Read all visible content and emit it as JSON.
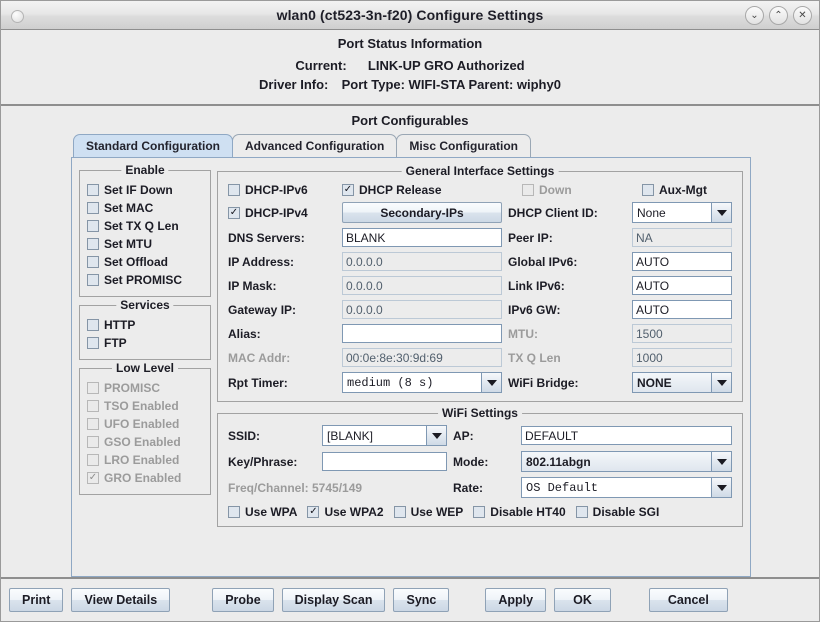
{
  "window": {
    "title": "wlan0  (ct523-3n-f20) Configure Settings",
    "buttons": [
      {
        "name": "minimize",
        "glyph": "⌄"
      },
      {
        "name": "maximize",
        "glyph": "⌃"
      },
      {
        "name": "close",
        "glyph": "✕"
      }
    ]
  },
  "status": {
    "heading": "Port Status Information",
    "current_label": "Current:",
    "current_value": "LINK-UP GRO  Authorized",
    "driver_label": "Driver Info:",
    "driver_value": "Port Type: WIFI-STA   Parent: wiphy0"
  },
  "port_configurables": {
    "heading": "Port Configurables",
    "tabs": [
      {
        "label": "Standard Configuration",
        "active": true
      },
      {
        "label": "Advanced Configuration",
        "active": false
      },
      {
        "label": "Misc Configuration",
        "active": false
      }
    ]
  },
  "enable_group": {
    "legend": "Enable",
    "items": [
      {
        "label": "Set IF Down",
        "checked": false,
        "disabled": false
      },
      {
        "label": "Set MAC",
        "checked": false,
        "disabled": false
      },
      {
        "label": "Set TX Q Len",
        "checked": false,
        "disabled": false
      },
      {
        "label": "Set MTU",
        "checked": false,
        "disabled": false
      },
      {
        "label": "Set Offload",
        "checked": false,
        "disabled": false
      },
      {
        "label": "Set PROMISC",
        "checked": false,
        "disabled": false
      }
    ]
  },
  "services_group": {
    "legend": "Services",
    "items": [
      {
        "label": "HTTP",
        "checked": false,
        "disabled": false
      },
      {
        "label": "FTP",
        "checked": false,
        "disabled": false
      }
    ]
  },
  "low_level_group": {
    "legend": "Low Level",
    "items": [
      {
        "label": "PROMISC",
        "checked": false,
        "disabled": true
      },
      {
        "label": "TSO Enabled",
        "checked": false,
        "disabled": true
      },
      {
        "label": "UFO Enabled",
        "checked": false,
        "disabled": true
      },
      {
        "label": "GSO Enabled",
        "checked": false,
        "disabled": true
      },
      {
        "label": "LRO Enabled",
        "checked": false,
        "disabled": true
      },
      {
        "label": "GRO Enabled",
        "checked": true,
        "disabled": true
      }
    ]
  },
  "general": {
    "legend": "General Interface Settings",
    "dhcp_ipv6": {
      "label": "DHCP-IPv6",
      "checked": false,
      "disabled": false
    },
    "dhcp_release": {
      "label": "DHCP Release",
      "checked": true,
      "disabled": false
    },
    "down": {
      "label": "Down",
      "checked": false,
      "disabled": true
    },
    "aux_mgt": {
      "label": "Aux-Mgt",
      "checked": false,
      "disabled": false
    },
    "dhcp_ipv4": {
      "label": "DHCP-IPv4",
      "checked": true,
      "disabled": false
    },
    "secondary_ips_button": "Secondary-IPs",
    "dhcp_client_id_label": "DHCP Client ID:",
    "dhcp_client_id_value": "None",
    "dns_servers_label": "DNS Servers:",
    "dns_servers_value": "BLANK",
    "peer_ip_label": "Peer IP:",
    "peer_ip_value": "NA",
    "ip_address_label": "IP Address:",
    "ip_address_value": "0.0.0.0",
    "global_ipv6_label": "Global IPv6:",
    "global_ipv6_value": "AUTO",
    "ip_mask_label": "IP Mask:",
    "ip_mask_value": "0.0.0.0",
    "link_ipv6_label": "Link IPv6:",
    "link_ipv6_value": "AUTO",
    "gateway_ip_label": "Gateway IP:",
    "gateway_ip_value": "0.0.0.0",
    "ipv6_gw_label": "IPv6 GW:",
    "ipv6_gw_value": "AUTO",
    "alias_label": "Alias:",
    "alias_value": "",
    "mtu_label": "MTU:",
    "mtu_value": "1500",
    "mac_addr_label": "MAC Addr:",
    "mac_addr_value": "00:0e:8e:30:9d:69",
    "tx_q_len_label": "TX Q Len",
    "tx_q_len_value": "1000",
    "rpt_timer_label": "Rpt Timer:",
    "rpt_timer_value": "medium  (8 s)",
    "wifi_bridge_label": "WiFi Bridge:",
    "wifi_bridge_value": "NONE"
  },
  "wifi": {
    "legend": "WiFi Settings",
    "ssid_label": "SSID:",
    "ssid_value": "[BLANK]",
    "ap_label": "AP:",
    "ap_value": "DEFAULT",
    "key_label": "Key/Phrase:",
    "key_value": "",
    "mode_label": "Mode:",
    "mode_value": "802.11abgn",
    "freq_label": "Freq/Channel: 5745/149",
    "rate_label": "Rate:",
    "rate_value": "OS Default",
    "checks": [
      {
        "label": "Use WPA",
        "checked": false
      },
      {
        "label": "Use WPA2",
        "checked": true
      },
      {
        "label": "Use WEP",
        "checked": false
      },
      {
        "label": "Disable HT40",
        "checked": false
      },
      {
        "label": "Disable SGI",
        "checked": false
      }
    ]
  },
  "bottom_bar": {
    "print": "Print",
    "view_details": "View Details",
    "probe": "Probe",
    "display_scan": "Display Scan",
    "sync": "Sync",
    "apply": "Apply",
    "ok": "OK",
    "cancel": "Cancel"
  }
}
